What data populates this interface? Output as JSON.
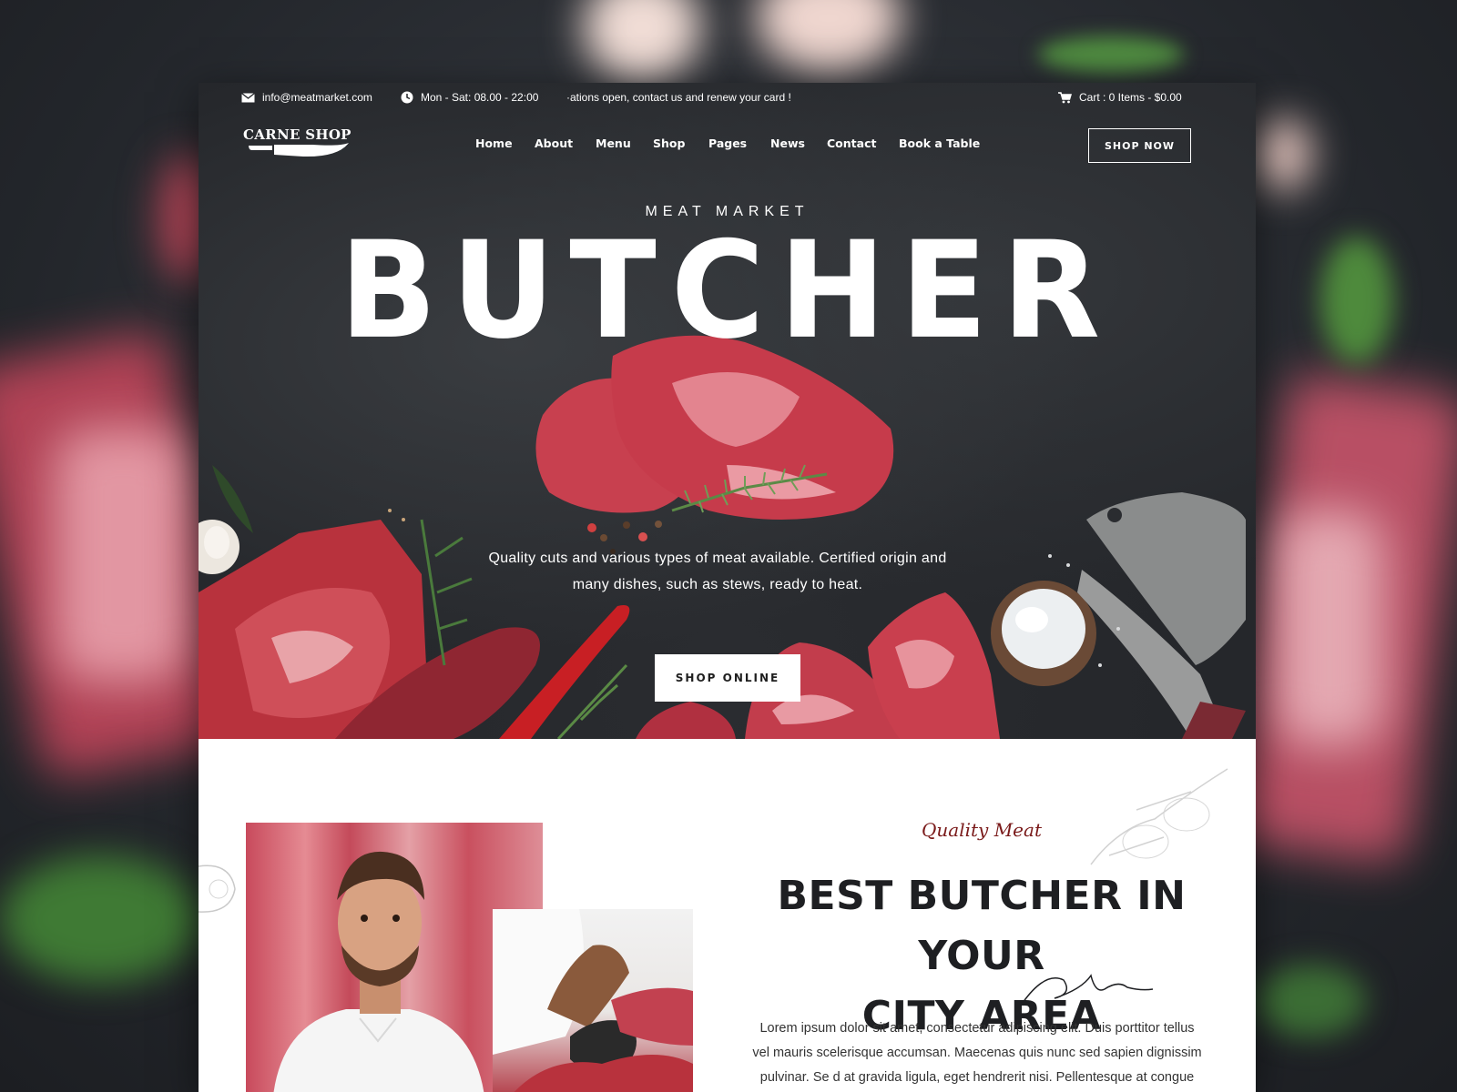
{
  "topbar": {
    "email": "info@meatmarket.com",
    "hours": "Mon - Sat: 08.00 - 22:00",
    "ticker": "·ations open, contact us and renew your card !",
    "cart": "Cart : 0 Items - $0.00"
  },
  "header": {
    "logo": "CARNE SHOP",
    "nav": [
      "Home",
      "About",
      "Menu",
      "Shop",
      "Pages",
      "News",
      "Contact",
      "Book a Table"
    ],
    "cta": "SHOP NOW"
  },
  "hero": {
    "eyebrow": "MEAT MARKET",
    "headline": "BUTCHER",
    "description": "Quality cuts and various types of meat available. Certified origin and many dishes, such as stews, ready to heat.",
    "button": "SHOP ONLINE"
  },
  "about": {
    "label": "Quality Meat",
    "title_line1": "BEST BUTCHER IN YOUR",
    "title_line2": "CITY AREA",
    "body": "Lorem ipsum dolor sit amet, consectetur adipiscing elit. Duis porttitor tellus vel mauris scelerisque accumsan. Maecenas quis nunc sed sapien dignissim pulvinar. Se d at gravida ligula, eget hendrerit nisi. Pellentesque at congue mauris, posuere fringilla"
  },
  "icons": {
    "email": "envelope-icon",
    "hours": "clock-icon",
    "cart": "cart-icon"
  },
  "colors": {
    "hero_bg": "#25272b",
    "accent_red": "#7a1a1a",
    "text_dark": "#1e1f22",
    "meat_red": "#b8323d"
  }
}
